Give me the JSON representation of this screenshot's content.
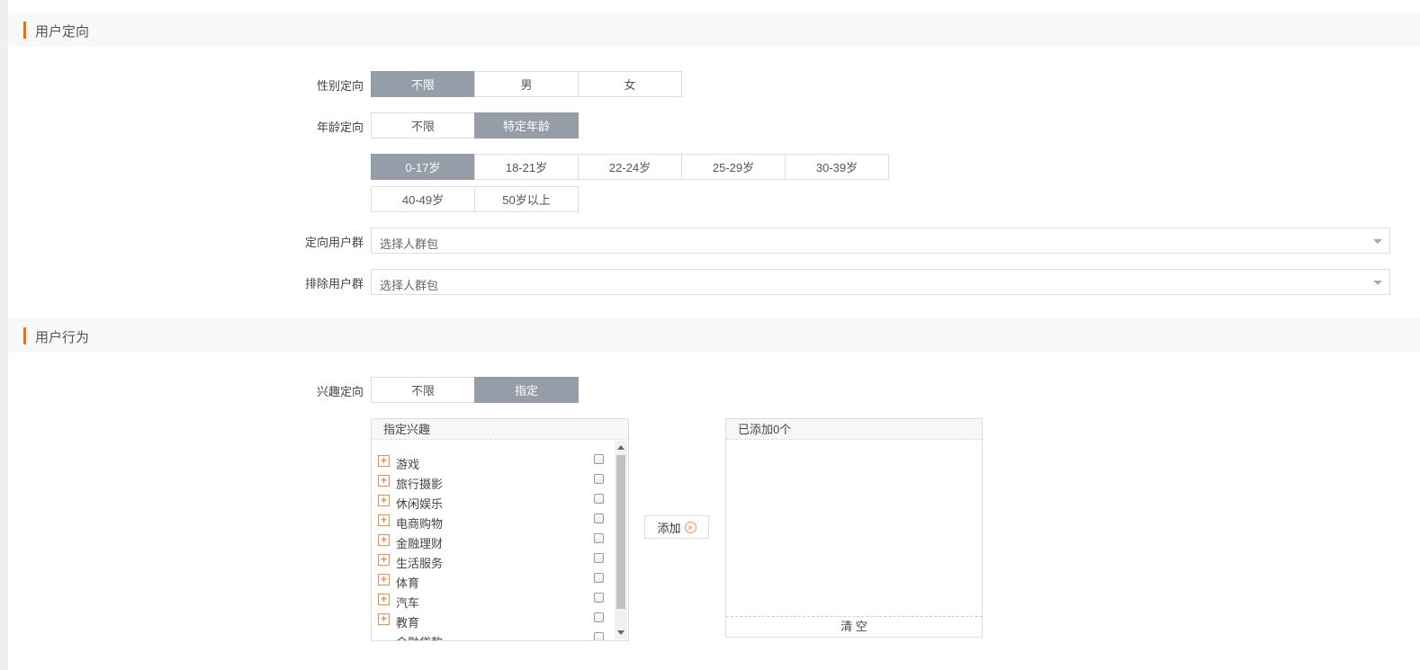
{
  "sections": {
    "user_targeting": "用户定向",
    "user_behavior": "用户行为"
  },
  "gender": {
    "label": "性别定向",
    "options": [
      "不限",
      "男",
      "女"
    ],
    "selected": "不限"
  },
  "age": {
    "label": "年龄定向",
    "options": [
      "不限",
      "特定年龄"
    ],
    "selected": "特定年龄",
    "ranges_row1": [
      "0-17岁",
      "18-21岁",
      "22-24岁",
      "25-29岁",
      "30-39岁"
    ],
    "ranges_row2": [
      "40-49岁",
      "50岁以上"
    ],
    "selected_range": "0-17岁"
  },
  "target_group": {
    "label": "定向用户群",
    "placeholder": "选择人群包"
  },
  "exclude_group": {
    "label": "排除用户群",
    "placeholder": "选择人群包"
  },
  "interest": {
    "label": "兴趣定向",
    "options": [
      "不限",
      "指定"
    ],
    "selected": "指定",
    "panel_title": "指定兴趣",
    "items": [
      "游戏",
      "旅行摄影",
      "休闲娱乐",
      "电商购物",
      "金融理财",
      "生活服务",
      "体育",
      "汽车",
      "教育",
      "金融贷款"
    ],
    "add_button": "添加",
    "added_title": "已添加0个",
    "clear_button": "清 空"
  },
  "colors": {
    "accent": "#ff6a00",
    "active_option": "#959ea8",
    "plus_icon": "#f08a4b"
  }
}
